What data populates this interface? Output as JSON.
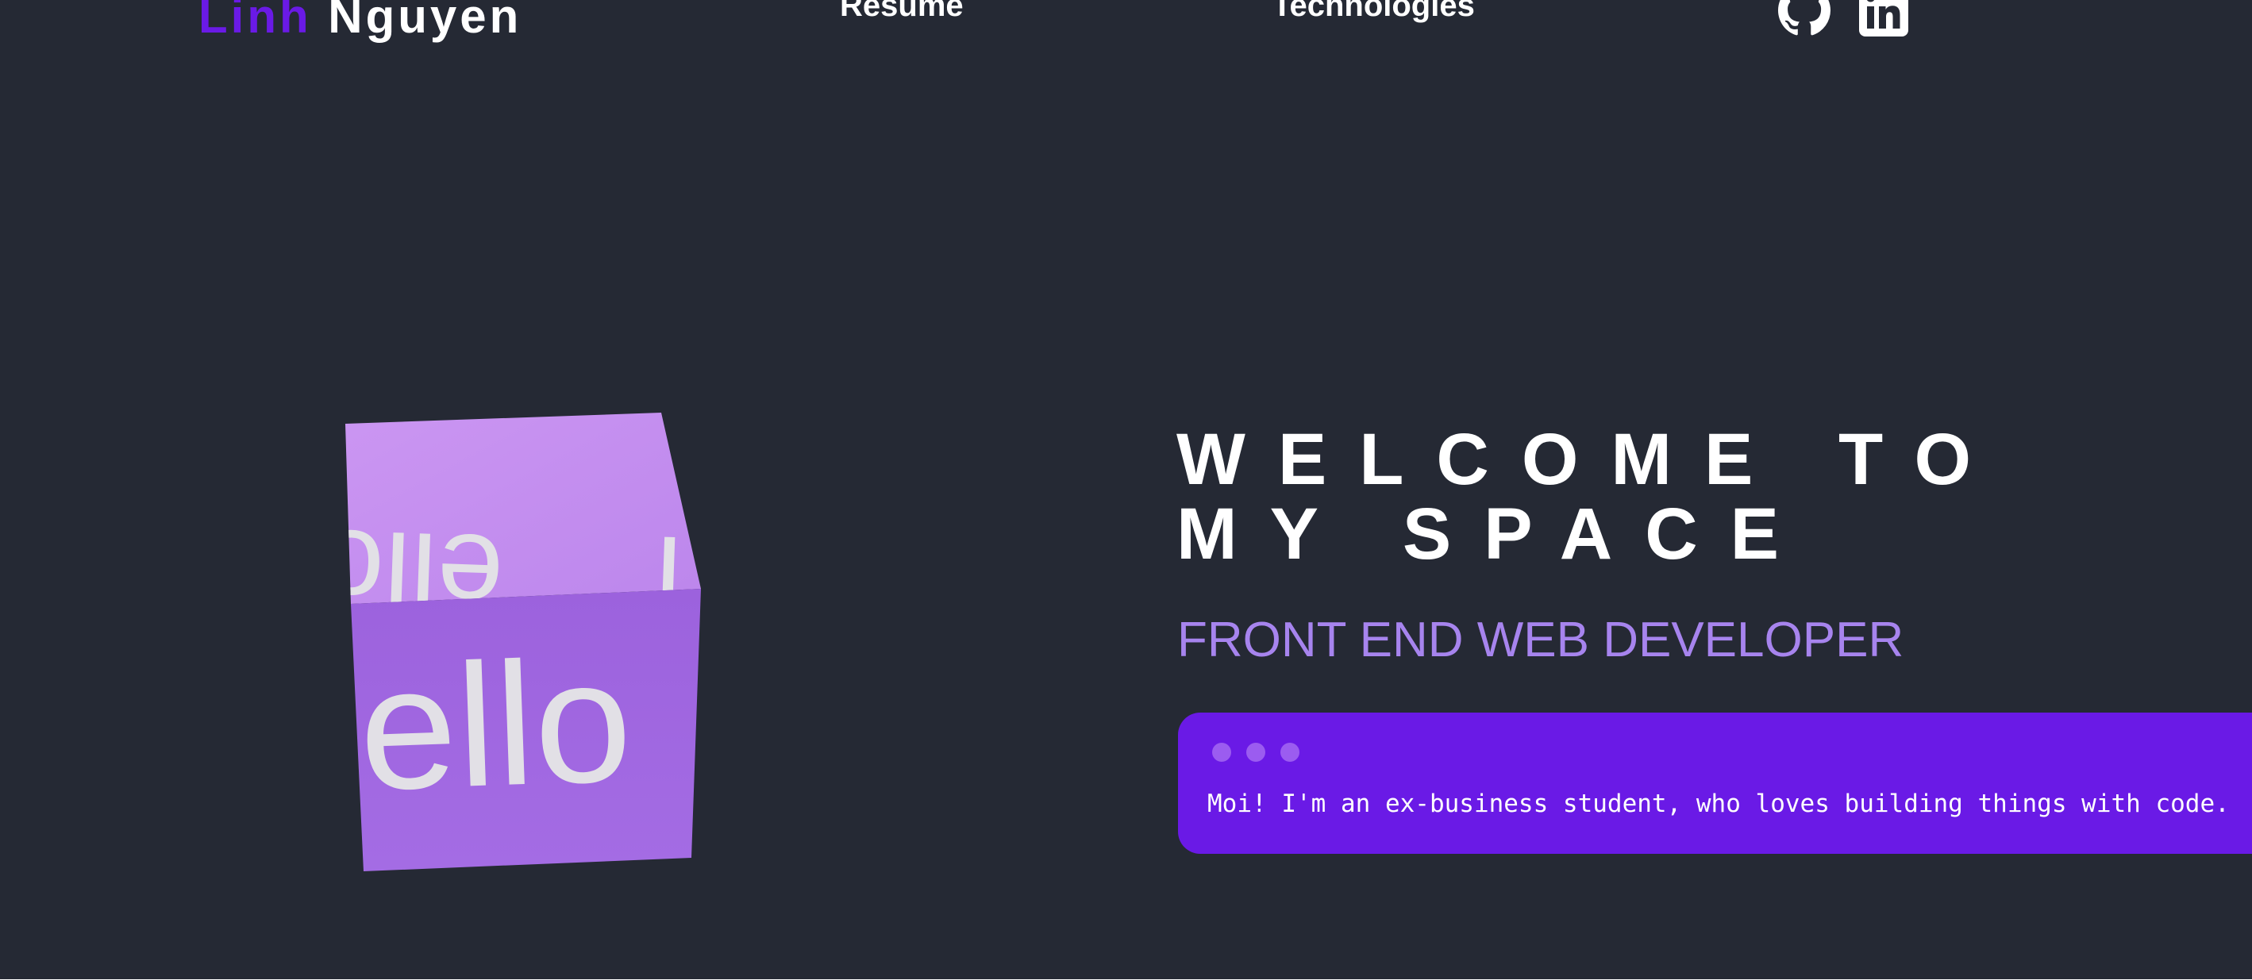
{
  "header": {
    "logo_first": "Linh",
    "logo_last": "Nguyen",
    "nav": [
      {
        "label": "Resume"
      },
      {
        "label": "Technologies"
      }
    ],
    "social": [
      {
        "icon": "github-icon"
      },
      {
        "icon": "linkedin-icon"
      }
    ]
  },
  "hero": {
    "cube": {
      "top_face_text": "ello",
      "top_face_text_trailing": "l",
      "front_face_text": "lello"
    },
    "title_line1": "WELCOME TO",
    "title_line2": "MY SPACE",
    "subtitle": "FRONT END WEB DEVELOPER",
    "terminal_text": "Moi! I'm an ex-business student, who loves building things with code."
  },
  "colors": {
    "background": "#252934",
    "accent": "#6a1ae6",
    "subtitle": "#a784ee",
    "cube_top": "#c28ef0",
    "cube_front": "#a068e2"
  }
}
